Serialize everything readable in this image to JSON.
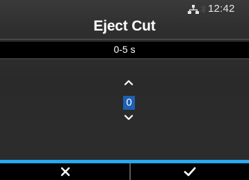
{
  "status": {
    "time": "12:42",
    "network_icon": "network-icon",
    "bluetooth_icon": "bluetooth-icon"
  },
  "header": {
    "title": "Eject Cut"
  },
  "setting": {
    "range": "0-5 s",
    "value": "0"
  },
  "softkeys": {
    "cancel_icon": "close-icon",
    "confirm_icon": "checkmark-icon"
  },
  "colors": {
    "accent": "#29a8f2",
    "selection": "#1f5fb4",
    "background": "#2b2b2b",
    "bar": "#000000"
  }
}
